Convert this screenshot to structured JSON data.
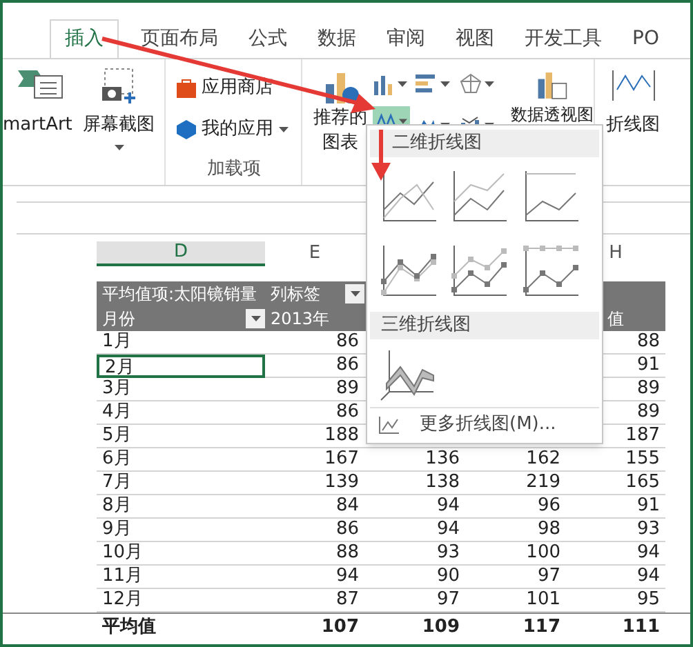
{
  "tabs": [
    {
      "label": "插入",
      "selected": true
    },
    {
      "label": "页面布局",
      "selected": false
    },
    {
      "label": "公式",
      "selected": false
    },
    {
      "label": "数据",
      "selected": false
    },
    {
      "label": "审阅",
      "selected": false
    },
    {
      "label": "视图",
      "selected": false
    },
    {
      "label": "开发工具",
      "selected": false
    },
    {
      "label": "PO",
      "selected": false
    }
  ],
  "ribbon": {
    "smartart": "martArt",
    "screenshot": "屏幕截图",
    "app_store": "应用商店",
    "my_apps": "我的应用",
    "addins_group": "加载项",
    "recommended_charts": [
      "推荐的",
      "图表"
    ],
    "line_chart_button_selected": true,
    "pivot_chart": "数据透视图",
    "sparkline_line": "折线图"
  },
  "dropdown": {
    "section_2d": "二维折线图",
    "section_3d": "三维折线图",
    "more": "更多折线图(M)..."
  },
  "column_headers": [
    {
      "label": "D",
      "selected": true
    },
    {
      "label": "E",
      "selected": false
    },
    {
      "label": "H",
      "selected": false
    }
  ],
  "pivot": {
    "values_label": "平均值项:太阳镜销量",
    "column_labels": "列标签",
    "row_labels": "月份",
    "year": "2013年",
    "h_header": "值",
    "rows": [
      {
        "month": "1月",
        "e": "86",
        "h": "88",
        "selected": false
      },
      {
        "month": "2月",
        "e": "86",
        "h": "91",
        "selected": true
      },
      {
        "month": "3月",
        "e": "89",
        "h": "89",
        "selected": false
      },
      {
        "month": "4月",
        "e": "86",
        "h": "89",
        "selected": false
      },
      {
        "month": "5月",
        "e": "188",
        "h": "187",
        "selected": false
      },
      {
        "month": "6月",
        "e": "167",
        "f": "136",
        "g": "162",
        "h": "155",
        "selected": false
      },
      {
        "month": "7月",
        "e": "139",
        "f": "138",
        "g": "219",
        "h": "165",
        "selected": false
      },
      {
        "month": "8月",
        "e": "84",
        "f": "94",
        "g": "96",
        "h": "91",
        "selected": false
      },
      {
        "month": "9月",
        "e": "86",
        "f": "94",
        "g": "98",
        "h": "93",
        "selected": false
      },
      {
        "month": "10月",
        "e": "88",
        "f": "93",
        "g": "100",
        "h": "94",
        "selected": false
      },
      {
        "month": "11月",
        "e": "94",
        "f": "90",
        "g": "97",
        "h": "94",
        "selected": false
      },
      {
        "month": "12月",
        "e": "87",
        "f": "97",
        "g": "101",
        "h": "95",
        "selected": false
      }
    ],
    "total": {
      "label": "平均值",
      "e": "107",
      "f": "109",
      "g": "117",
      "h": "111"
    }
  }
}
